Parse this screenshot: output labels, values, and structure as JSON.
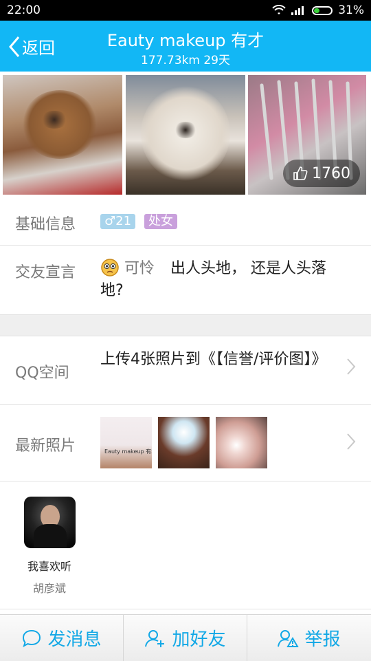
{
  "status_bar": {
    "time": "22:00",
    "battery": "31%",
    "battery_level": 0.31
  },
  "header": {
    "back_label": "返回",
    "title": "Eauty makeup 有才",
    "subtitle": "177.73km 29天"
  },
  "photos": {
    "likes": "1760"
  },
  "basic_info": {
    "label": "基础信息",
    "gender_age": "♂21",
    "zodiac": "处女"
  },
  "declaration": {
    "label": "交友宣言",
    "emoji_text": "可怜",
    "text": "出人头地， 还是人头落地?"
  },
  "qzone": {
    "label": "QQ空间",
    "text": "上传4张照片到《【信誉/评价图】》"
  },
  "latest_photos": {
    "label": "最新照片",
    "thumb1_caption": "Eauty makeup 有才"
  },
  "music": {
    "line1": "我喜欢听",
    "line2": "胡彦斌"
  },
  "bottom_bar": {
    "message": "发消息",
    "add_friend": "加好友",
    "report": "举报"
  },
  "colors": {
    "accent": "#12b7f5",
    "button_text": "#12a8e6",
    "male_tag": "#a8d4ec",
    "zodiac_tag": "#c9a0dc"
  }
}
